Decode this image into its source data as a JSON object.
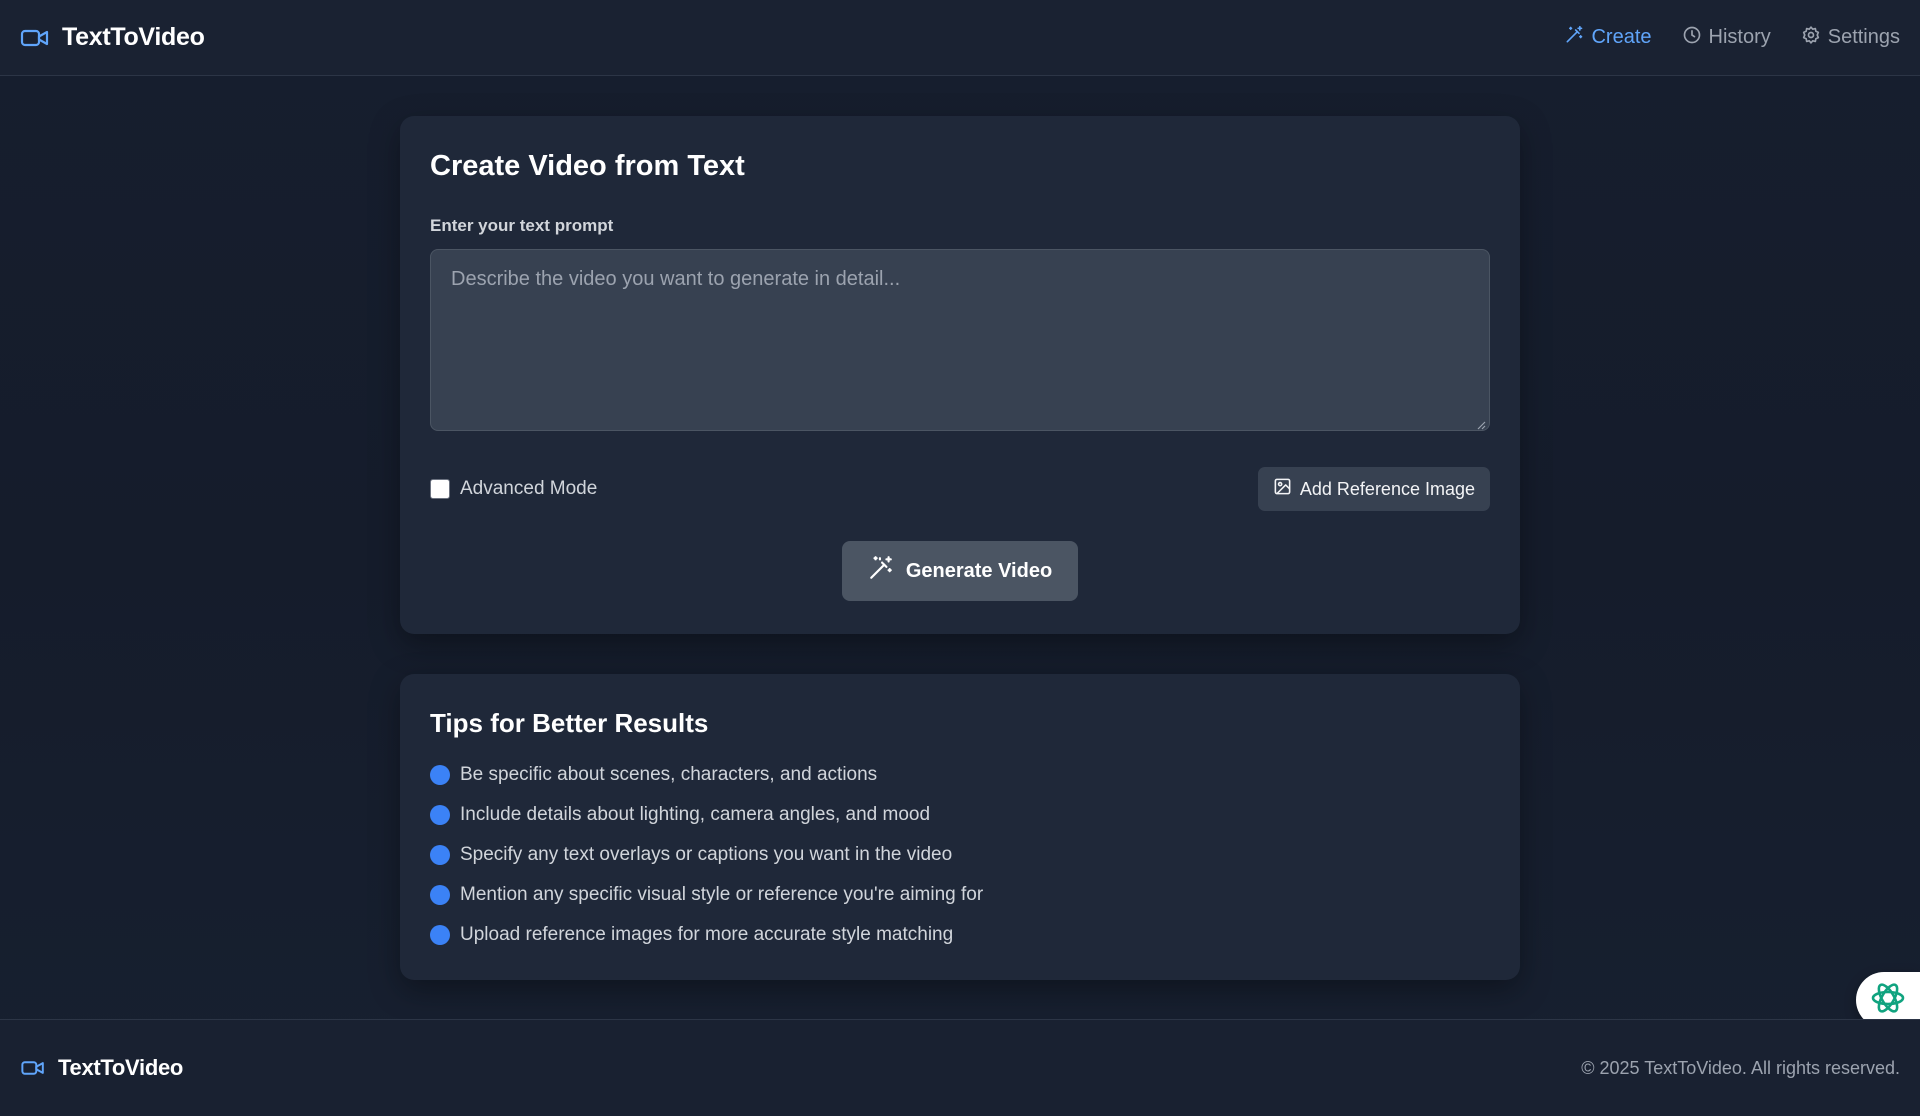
{
  "app": {
    "name": "TextToVideo"
  },
  "nav": {
    "items": [
      {
        "label": "Create",
        "icon": "wand-icon",
        "active": true
      },
      {
        "label": "History",
        "icon": "clock-icon",
        "active": false
      },
      {
        "label": "Settings",
        "icon": "gear-icon",
        "active": false
      }
    ]
  },
  "create": {
    "title": "Create Video from Text",
    "prompt_label": "Enter your text prompt",
    "prompt_placeholder": "Describe the video you want to generate in detail...",
    "prompt_value": "",
    "advanced_mode_label": "Advanced Mode",
    "advanced_mode_checked": false,
    "add_reference_label": "Add Reference Image",
    "generate_label": "Generate Video"
  },
  "tips": {
    "title": "Tips for Better Results",
    "items": [
      "Be specific about scenes, characters, and actions",
      "Include details about lighting, camera angles, and mood",
      "Specify any text overlays or captions you want in the video",
      "Mention any specific visual style or reference you're aiming for",
      "Upload reference images for more accurate style matching"
    ]
  },
  "footer": {
    "brand": "TextToVideo",
    "copyright": "© 2025 TextToVideo. All rights reserved."
  },
  "colors": {
    "accent": "#60a5fa",
    "bullet": "#3b82f6",
    "card": "#1f2839",
    "background": "#151c2b"
  }
}
